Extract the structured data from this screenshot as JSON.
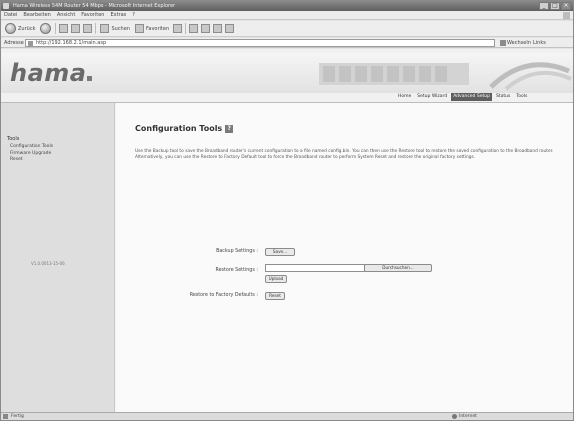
{
  "window": {
    "title": "Hama Wireless 54M Router 54 Mbps - Microsoft Internet Explorer",
    "buttons": {
      "min": "_",
      "max": "□",
      "close": "×"
    }
  },
  "menu": [
    "Datei",
    "Bearbeiten",
    "Ansicht",
    "Favoriten",
    "Extras",
    "?"
  ],
  "toolbar": {
    "back_label": "Zurück",
    "search_label": "Suchen",
    "favorites_label": "Favoriten"
  },
  "address": {
    "label": "Adresse",
    "url": "http://192.168.2.1/main.asp",
    "go_label": "Wechseln zu",
    "links_label": "Links"
  },
  "brand": {
    "name": "hama"
  },
  "nav": [
    "Home",
    "Setup Wizard",
    "Advanced Setup",
    "Status",
    "Tools"
  ],
  "sidebar": {
    "section_label": "Tools",
    "items": [
      "Configuration Tools",
      "Firmware Upgrade",
      "Reset"
    ],
    "firmware": "V1.0.0013-15-06"
  },
  "main": {
    "title": "Configuration Tools",
    "help_icon": "?",
    "description": "Use the Backup tool to save the Broadband router's current configuration to a file named config.bin. You can then use the Restore tool to restore the saved configuration to the Broadband router. Alternatively, you can use the Restore to Factory Default tool to force the Broadband router to perform System Reset and restore the original factory settings.",
    "backup_label": "Backup Settings :",
    "backup_button": "Save...",
    "restore_label": "Restore Settings :",
    "browse_button": "Durchsuchen...",
    "upload_button": "Upload",
    "factory_label": "Restore to Factory Defaults :",
    "reset_button": "Reset"
  },
  "statusbar": {
    "left": "Fertig",
    "zone": "Internet"
  }
}
